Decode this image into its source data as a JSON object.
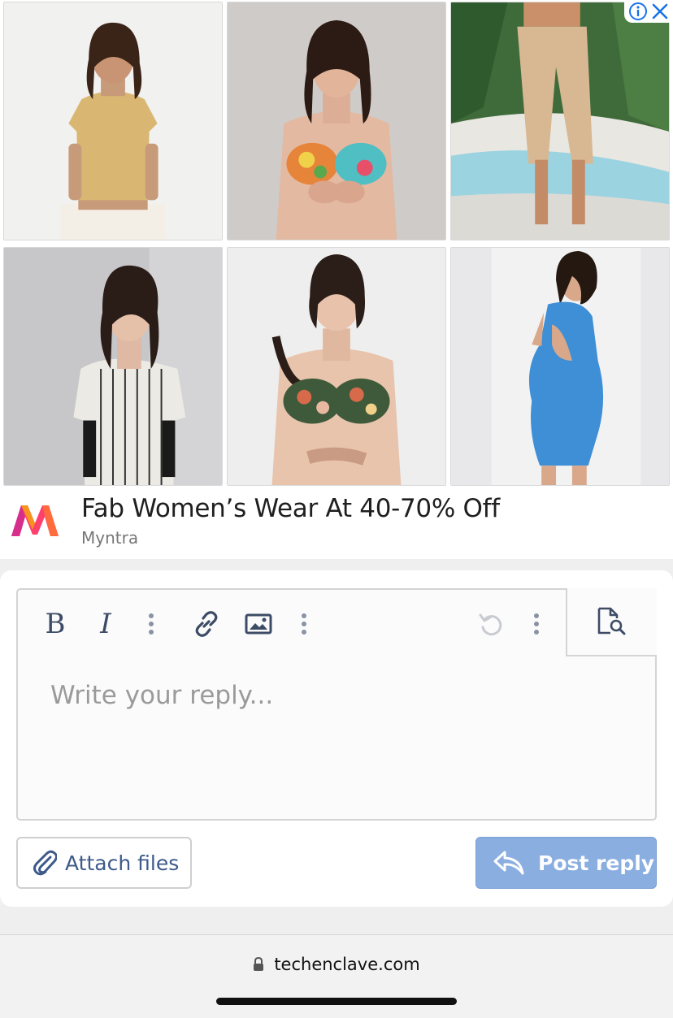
{
  "ad": {
    "headline": "Fab Women’s Wear At 40-70% Off",
    "advertiser": "Myntra",
    "products": [
      {
        "name": "beige-crop-top"
      },
      {
        "name": "floral-bra"
      },
      {
        "name": "crochet-skirt"
      },
      {
        "name": "printed-kurta-top"
      },
      {
        "name": "green-floral-bra"
      },
      {
        "name": "blue-bodycon-dress"
      }
    ]
  },
  "editor": {
    "placeholder": "Write your reply...",
    "toolbar": {
      "bold": "B",
      "italic": "I"
    }
  },
  "actions": {
    "attach_label": "Attach files",
    "post_label": "Post reply"
  },
  "browser": {
    "url": "techenclave.com"
  },
  "colors": {
    "post_button": "#8aaee0",
    "toolbar_icon": "#3d4c66",
    "adchoices": "#1a73e8"
  }
}
